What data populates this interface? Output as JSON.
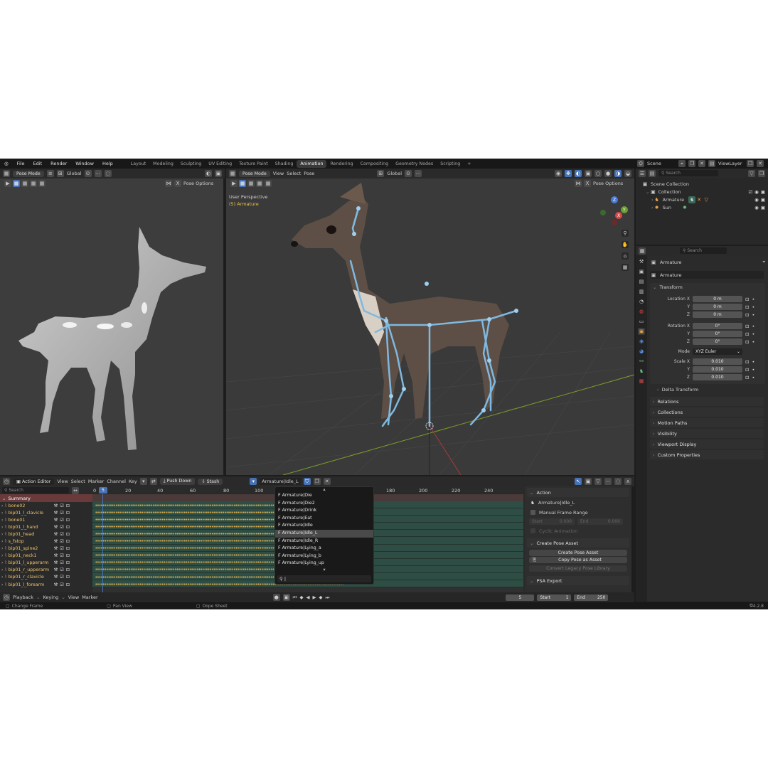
{
  "menu": {
    "items": [
      "File",
      "Edit",
      "Render",
      "Window",
      "Help"
    ]
  },
  "workspaces": {
    "tabs": [
      "Layout",
      "Modeling",
      "Sculpting",
      "UV Editing",
      "Texture Paint",
      "Shading",
      "Animation",
      "Rendering",
      "Compositing",
      "Geometry Nodes",
      "Scripting"
    ],
    "active": "Animation"
  },
  "scene": {
    "label": "Scene",
    "view_layer": "ViewLayer"
  },
  "viewport_left": {
    "mode": "Pose Mode",
    "orientation": "Global",
    "pose_options": "Pose Options"
  },
  "viewport_main": {
    "mode": "Pose Mode",
    "menus": [
      "View",
      "Select",
      "Pose"
    ],
    "orientation": "Global",
    "pose_options": "Pose Options",
    "perspective": "User Perspective",
    "object_label": "(5) Armature"
  },
  "outliner": {
    "search_placeholder": "Search",
    "scene_collection": "Scene Collection",
    "collection": "Collection",
    "items": [
      {
        "name": "Armature"
      },
      {
        "name": "Sun"
      }
    ]
  },
  "properties": {
    "search_placeholder": "Search",
    "object_name": "Armature",
    "data_name": "Armature",
    "transform_title": "Transform",
    "location": {
      "label": "Location X",
      "x": "0 m",
      "y": "0 m",
      "z": "0 m"
    },
    "rotation": {
      "label": "Rotation X",
      "x": "0°",
      "y": "0°",
      "z": "0°"
    },
    "mode": {
      "label": "Mode",
      "value": "XYZ Euler"
    },
    "scale": {
      "label": "Scale X",
      "x": "0.010",
      "y": "0.010",
      "z": "0.010"
    },
    "axis_y": "Y",
    "axis_z": "Z",
    "delta": "Delta Transform",
    "sections": [
      "Relations",
      "Collections",
      "Motion Paths",
      "Visibility",
      "Viewport Display",
      "Custom Properties"
    ]
  },
  "action_editor": {
    "editor_type": "Action Editor",
    "menus": [
      "View",
      "Select",
      "Marker",
      "Channel",
      "Key"
    ],
    "push_down": "Push Down",
    "stash": "Stash",
    "action_name": "Armature|Idle_L",
    "search_placeholder": "Search",
    "ticks": [
      "0",
      "5",
      "20",
      "40",
      "60",
      "80",
      "100",
      "180",
      "200",
      "220",
      "240"
    ],
    "summary": "Summary",
    "channels": [
      "bone02",
      "bip01_l_clavicle",
      "bone01",
      "bip01_l_hand",
      "bip01_head",
      "s_fstop",
      "bip01_spine2",
      "bip01_neck1",
      "bip01_l_upperarm",
      "bip01_r_upperarm",
      "bip01_r_clavicle",
      "bip01_l_forearm"
    ]
  },
  "action_dropdown": {
    "items": [
      "F Armature|Die",
      "F Armature|Die2",
      "F Armature|Drink",
      "F Armature|Eat",
      "F Armature|Idle",
      "F Armature|Idle_L",
      "F Armature|Idle_R",
      "F Armature|Lying_a",
      "F Armature|Lying_b",
      "F Armature|Lying_up"
    ],
    "selected_index": 5
  },
  "action_panel": {
    "title": "Action",
    "action_name": "Armature|Idle_L",
    "manual_frame_range": "Manual Frame Range",
    "start_label": "Start",
    "start_value": "0.000",
    "end_label": "End",
    "end_value": "0.000",
    "cyclic": "Cyclic Animation",
    "pose_asset_title": "Create Pose Asset",
    "create_pose_asset": "Create Pose Asset",
    "copy_pose_asset": "Copy Pose as Asset",
    "convert_legacy": "Convert Legacy Pose Library",
    "psa_export": "PSA Export"
  },
  "playback": {
    "menus": [
      "Playback",
      "Keying",
      "View",
      "Marker"
    ],
    "current_frame": "5",
    "start_label": "Start",
    "start_value": "1",
    "end_label": "End",
    "end_value": "250"
  },
  "statusbar": {
    "items": [
      "Change Frame",
      "Pan View",
      "Dope Sheet"
    ],
    "version": "4.2.8"
  },
  "colors": {
    "accent": "#4772b3",
    "bone": "#7fb8e0",
    "keyframe": "#e0b050",
    "channel_strip": "#2e4d44"
  }
}
